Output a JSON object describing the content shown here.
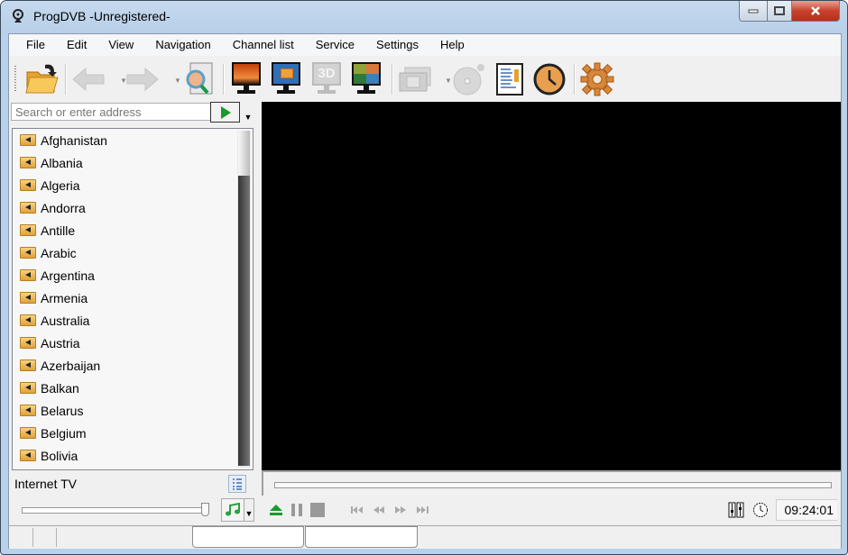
{
  "window": {
    "title": "ProgDVB -Unregistered-",
    "app_icon": "satellite-dish-icon",
    "caption_buttons": {
      "minimize": "minimize",
      "maximize": "maximize",
      "close": "close"
    }
  },
  "menubar": {
    "items": [
      "File",
      "Edit",
      "View",
      "Navigation",
      "Channel list",
      "Service",
      "Settings",
      "Help"
    ]
  },
  "toolbar": {
    "buttons": [
      {
        "name": "open-folder-icon",
        "tooltip": "Open",
        "enabled": true
      },
      {
        "name": "back-arrow-icon",
        "tooltip": "Back",
        "enabled": false
      },
      {
        "name": "forward-arrow-icon",
        "tooltip": "Forward",
        "enabled": false
      },
      {
        "name": "search-channels-icon",
        "tooltip": "Search",
        "enabled": true
      },
      {
        "name": "fullscreen-monitor-icon",
        "tooltip": "Full screen",
        "enabled": true
      },
      {
        "name": "window-mode-monitor-icon",
        "tooltip": "Window",
        "enabled": true
      },
      {
        "name": "3d-monitor-icon",
        "tooltip": "3D",
        "enabled": false,
        "label": "3D"
      },
      {
        "name": "mosaic-monitor-icon",
        "tooltip": "Mosaic",
        "enabled": true
      },
      {
        "name": "recordings-film-icon",
        "tooltip": "Recordings",
        "enabled": false
      },
      {
        "name": "disc-icon",
        "tooltip": "Disc",
        "enabled": false
      },
      {
        "name": "info-document-icon",
        "tooltip": "Info",
        "enabled": true
      },
      {
        "name": "scheduler-clock-icon",
        "tooltip": "Scheduler",
        "enabled": true
      },
      {
        "name": "settings-gear-icon",
        "tooltip": "Settings",
        "enabled": true
      }
    ]
  },
  "search": {
    "placeholder": "Search or enter address",
    "value": ""
  },
  "channel_list": {
    "items": [
      "Afghanistan",
      "Albania",
      "Algeria",
      "Andorra",
      "Antille",
      "Arabic",
      "Argentina",
      "Armenia",
      "Australia",
      "Austria",
      "Azerbaijan",
      "Balkan",
      "Belarus",
      "Belgium",
      "Bolivia"
    ],
    "source_label": "Internet TV"
  },
  "player": {
    "seek_progress": 0,
    "volume": 1.0,
    "clock": "09:24:01"
  },
  "colors": {
    "titlebar": "#b9d1ea",
    "close_button": "#c7422c",
    "video_bg": "#000000",
    "play_green": "#1a9a2a"
  }
}
